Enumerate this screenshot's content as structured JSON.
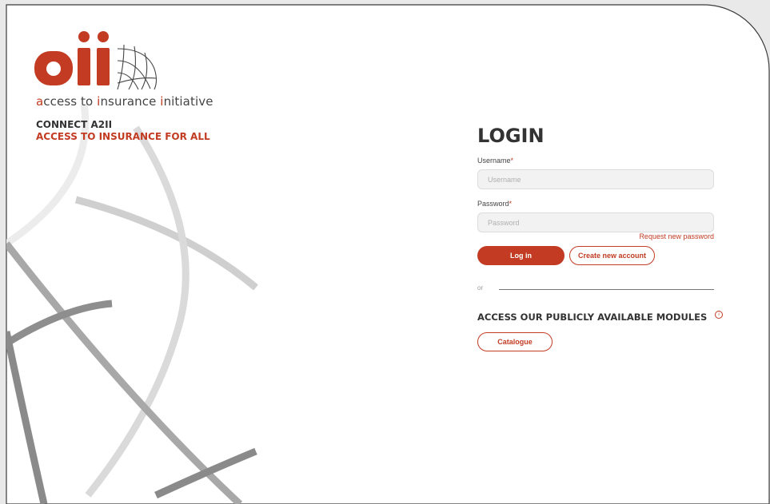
{
  "brand": {
    "logo_text": "aii",
    "tagline": [
      {
        "text": "a",
        "hl": true
      },
      {
        "text": "ccess to ",
        "hl": false
      },
      {
        "text": "i",
        "hl": true
      },
      {
        "text": "nsurance ",
        "hl": false
      },
      {
        "text": "i",
        "hl": true
      },
      {
        "text": "nitiative",
        "hl": false
      }
    ],
    "connect": "CONNECT A2II",
    "slogan": "ACCESS TO INSURANCE FOR ALL"
  },
  "login": {
    "title": "LOGIN",
    "username_label": "Username",
    "username_placeholder": "Username",
    "password_label": "Password",
    "password_placeholder": "Password",
    "required_mark": "*",
    "request_password": "Request new password",
    "login_button": "Log in",
    "create_account_button": "Create new account",
    "or": "or"
  },
  "modules": {
    "heading": "ACCESS OUR PUBLICLY AVAILABLE MODULES",
    "info_icon": "info-circle-icon",
    "info_glyph": "i",
    "catalogue_button": "Catalogue"
  },
  "colors": {
    "accent": "#c23b22",
    "text_dark": "#333333",
    "background_outer": "#e9e9e9",
    "panel": "#ffffff"
  }
}
